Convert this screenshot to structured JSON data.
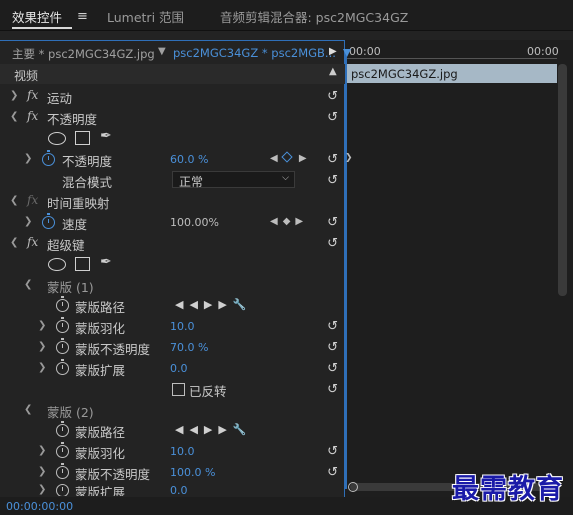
{
  "tabs": {
    "effects": "效果控件",
    "lumetri": "Lumetri 范围",
    "mixer": "音频剪辑混合器: psc2MGC34GZ"
  },
  "clip_tabs": {
    "master": "主要 * psc2MGC34GZ.jpg",
    "sequence": "psc2MGC34GZ * psc2MGB..."
  },
  "section": {
    "video": "视频"
  },
  "effects": {
    "motion": "运动",
    "opacity": "不透明度",
    "opacity_prop": "不透明度",
    "opacity_value": "60.0 %",
    "blend_mode": "混合模式",
    "blend_value": "正常",
    "time_remap": "时间重映射",
    "speed": "速度",
    "speed_value": "100.00%",
    "ultrakey": "超级键"
  },
  "mask1": {
    "title": "蒙版 (1)",
    "path": "蒙版路径",
    "feather": "蒙版羽化",
    "feather_value": "10.0",
    "opacity": "蒙版不透明度",
    "opacity_value": "70.0 %",
    "expansion": "蒙版扩展",
    "expansion_value": "0.0",
    "inverted": "已反转"
  },
  "mask2": {
    "title": "蒙版 (2)",
    "path": "蒙版路径",
    "feather": "蒙版羽化",
    "feather_value": "10.0",
    "opacity": "蒙版不透明度",
    "opacity_value": "100.0 %",
    "expansion": "蒙版扩展",
    "expansion_value": "0.0"
  },
  "timeline": {
    "start": "00:00",
    "end": "00:00",
    "clip": "psc2MGC34GZ.jpg"
  },
  "footer": {
    "timecode": "00:00:00:00"
  },
  "watermark": "最需教育",
  "icons": {
    "reset": "reset-icon",
    "stopwatch": "stopwatch-icon",
    "pen": "pen-icon"
  },
  "colors": {
    "accent": "#4a90d9",
    "panel_border": "#2f6fb8",
    "clip": "#a6b8c6"
  }
}
